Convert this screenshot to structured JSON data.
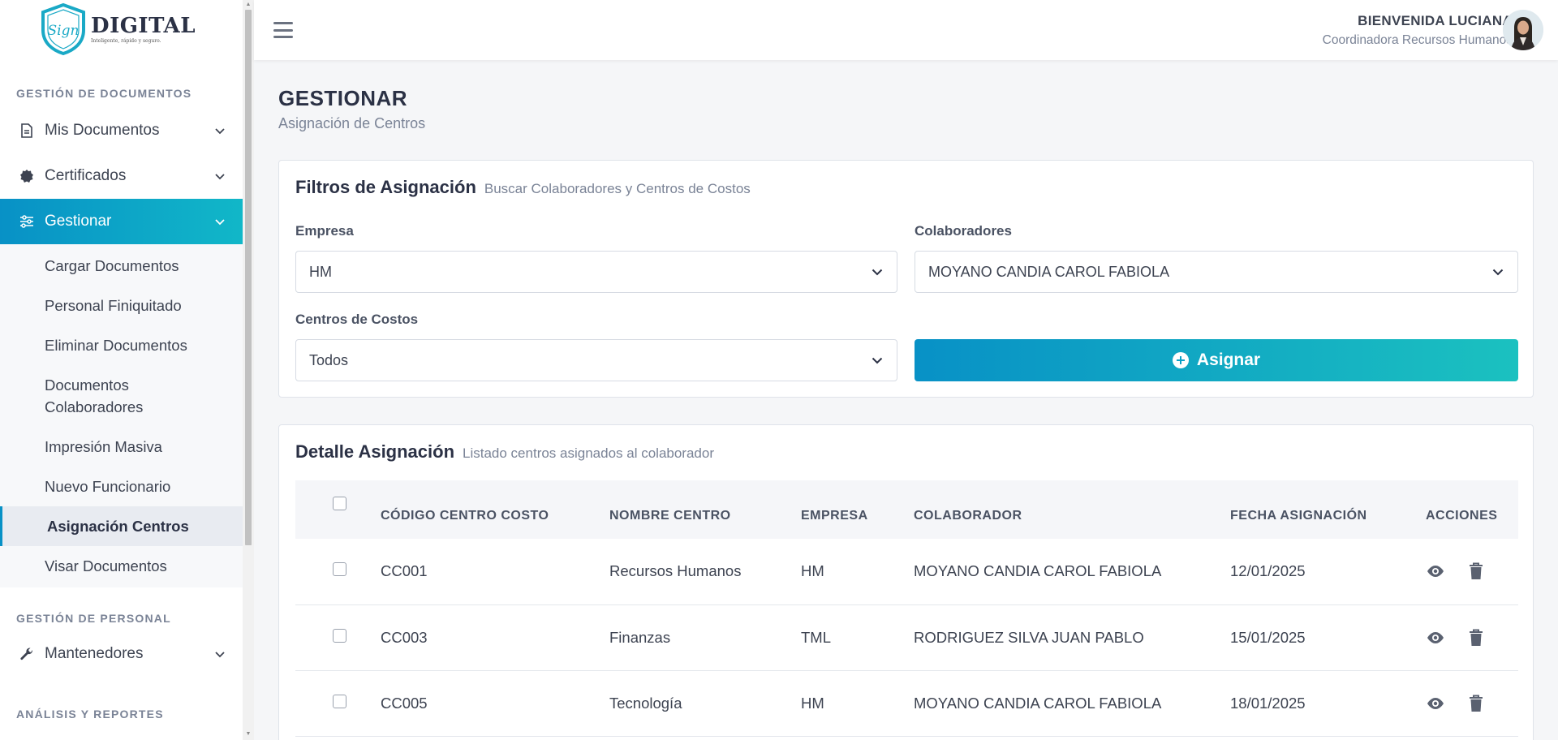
{
  "brand": {
    "name": "DIGITAL",
    "script": "Sign",
    "tagline": "Inteligente, rápido y seguro."
  },
  "sidebar": {
    "sections": [
      {
        "title": "GESTIÓN DE DOCUMENTOS"
      },
      {
        "title": "GESTIÓN DE PERSONAL"
      },
      {
        "title": "ANÁLISIS Y REPORTES"
      }
    ],
    "items": [
      {
        "label": "Mis Documentos",
        "icon": "document-icon"
      },
      {
        "label": "Certificados",
        "icon": "badge-icon"
      },
      {
        "label": "Gestionar",
        "icon": "sliders-icon",
        "active": true
      },
      {
        "label": "Mantenedores",
        "icon": "wrench-icon"
      }
    ],
    "submenu": [
      {
        "label": "Cargar Documentos"
      },
      {
        "label": "Personal Finiquitado"
      },
      {
        "label": "Eliminar Documentos"
      },
      {
        "label": "Documentos Colaboradores"
      },
      {
        "label": "Impresión Masiva"
      },
      {
        "label": "Nuevo Funcionario"
      },
      {
        "label": "Asignación Centros",
        "current": true
      },
      {
        "label": "Visar Documentos"
      }
    ]
  },
  "header": {
    "greeting_prefix": "BIENVENIDA",
    "user_name": "LUCIANA",
    "role": "Coordinadora Recursos Humanos"
  },
  "page": {
    "title": "GESTIONAR",
    "subtitle": "Asignación de Centros"
  },
  "filters": {
    "title": "Filtros de Asignación",
    "subtitle": "Buscar Colaboradores y Centros de Costos",
    "empresa_label": "Empresa",
    "empresa_value": "HM",
    "colaboradores_label": "Colaboradores",
    "colaboradores_value": "MOYANO CANDIA CAROL FABIOLA",
    "centros_label": "Centros de Costos",
    "centros_value": "Todos",
    "assign_button": "Asignar"
  },
  "detail": {
    "title": "Detalle Asignación",
    "subtitle": "Listado centros asignados al colaborador",
    "columns": [
      "CÓDIGO CENTRO COSTO",
      "NOMBRE CENTRO",
      "EMPRESA",
      "COLABORADOR",
      "FECHA ASIGNACIÓN",
      "ACCIONES"
    ],
    "rows": [
      {
        "codigo": "CC001",
        "nombre": "Recursos Humanos",
        "empresa": "HM",
        "colaborador": "MOYANO CANDIA CAROL FABIOLA",
        "fecha": "12/01/2025"
      },
      {
        "codigo": "CC003",
        "nombre": "Finanzas",
        "empresa": "TML",
        "colaborador": "RODRIGUEZ SILVA JUAN PABLO",
        "fecha": "15/01/2025"
      },
      {
        "codigo": "CC005",
        "nombre": "Tecnología",
        "empresa": "HM",
        "colaborador": "MOYANO CANDIA CAROL FABIOLA",
        "fecha": "18/01/2025"
      }
    ]
  },
  "colors": {
    "accent": "#0891c6",
    "accent_end": "#1bc1c0",
    "text": "#3d4351",
    "muted": "#7a8396"
  }
}
